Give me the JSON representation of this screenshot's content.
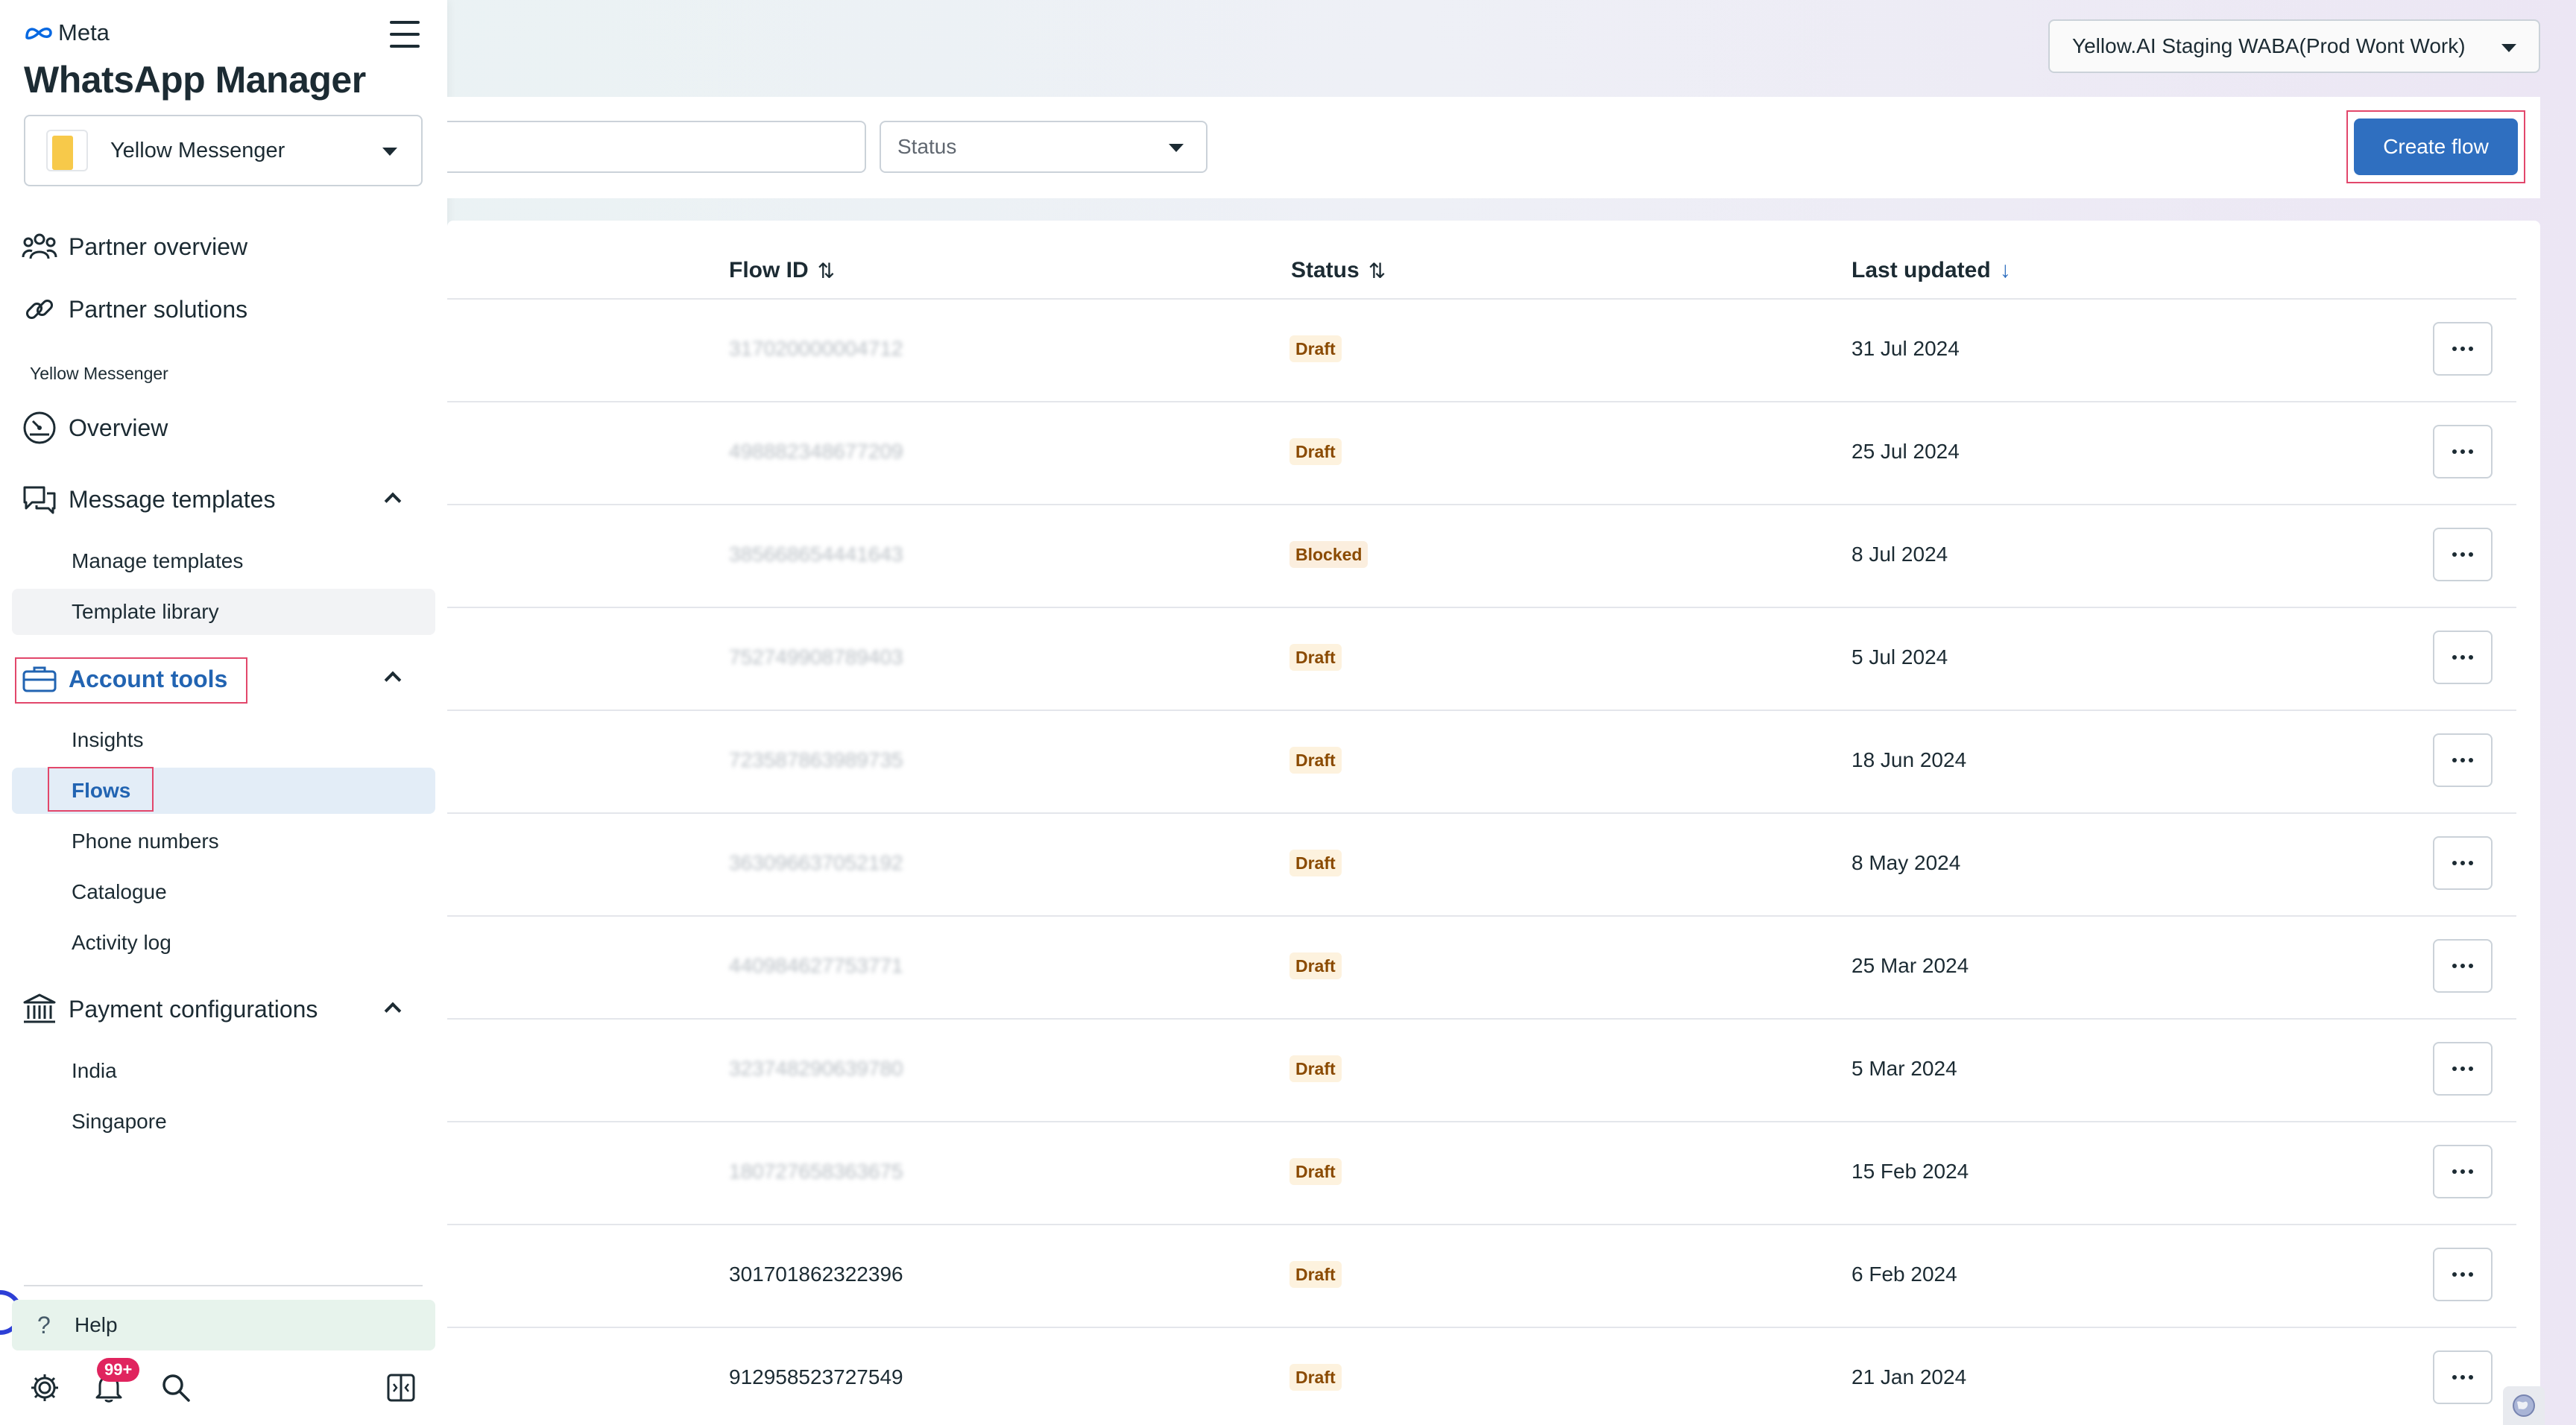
{
  "sidebar": {
    "brand": "Meta",
    "app_title": "WhatsApp Manager",
    "business_selector": "Yellow Messenger",
    "nav": {
      "partner_overview": "Partner overview",
      "partner_solutions": "Partner solutions",
      "section_label": "Yellow Messenger",
      "overview": "Overview",
      "message_templates": "Message templates",
      "manage_templates": "Manage templates",
      "template_library": "Template library",
      "account_tools": "Account tools",
      "insights": "Insights",
      "flows": "Flows",
      "phone_numbers": "Phone numbers",
      "catalogue": "Catalogue",
      "activity_log": "Activity log",
      "payment_configurations": "Payment configurations",
      "india": "India",
      "singapore": "Singapore"
    },
    "help": "Help",
    "notifications_badge": "99+"
  },
  "header": {
    "waba_selector": "Yellow.AI Staging WABA(Prod Wont Work)"
  },
  "toolbar": {
    "status_filter": "Status",
    "create_flow": "Create flow"
  },
  "table": {
    "columns": {
      "flow_id": "Flow ID",
      "status": "Status",
      "last_updated": "Last updated"
    },
    "rows": [
      {
        "flow_id": "317020000004712",
        "status": "Draft",
        "last_updated": "31 Jul 2024"
      },
      {
        "flow_id": "498882348677209",
        "status": "Draft",
        "last_updated": "25 Jul 2024"
      },
      {
        "flow_id": "385668654441643",
        "status": "Blocked",
        "last_updated": "8 Jul 2024"
      },
      {
        "flow_id": "752749908789403",
        "status": "Draft",
        "last_updated": "5 Jul 2024"
      },
      {
        "flow_id": "723587863989735",
        "status": "Draft",
        "last_updated": "18 Jun 2024"
      },
      {
        "flow_id": "363096637052192",
        "status": "Draft",
        "last_updated": "8 May 2024"
      },
      {
        "flow_id": "440984627753771",
        "status": "Draft",
        "last_updated": "25 Mar 2024"
      },
      {
        "flow_id": "323748290639780",
        "status": "Draft",
        "last_updated": "5 Mar 2024"
      },
      {
        "flow_id": "180727658363675",
        "status": "Draft",
        "last_updated": "15 Feb 2024"
      },
      {
        "flow_id": "301701862322396",
        "status": "Draft",
        "last_updated": "6 Feb 2024"
      },
      {
        "flow_id": "912958523727549",
        "status": "Draft",
        "last_updated": "21 Jan 2024"
      }
    ]
  },
  "colors": {
    "accent": "#2f6fc0",
    "highlight": "#e2476b",
    "draft_bg": "#fdf2de",
    "draft_text": "#8a4a00"
  }
}
